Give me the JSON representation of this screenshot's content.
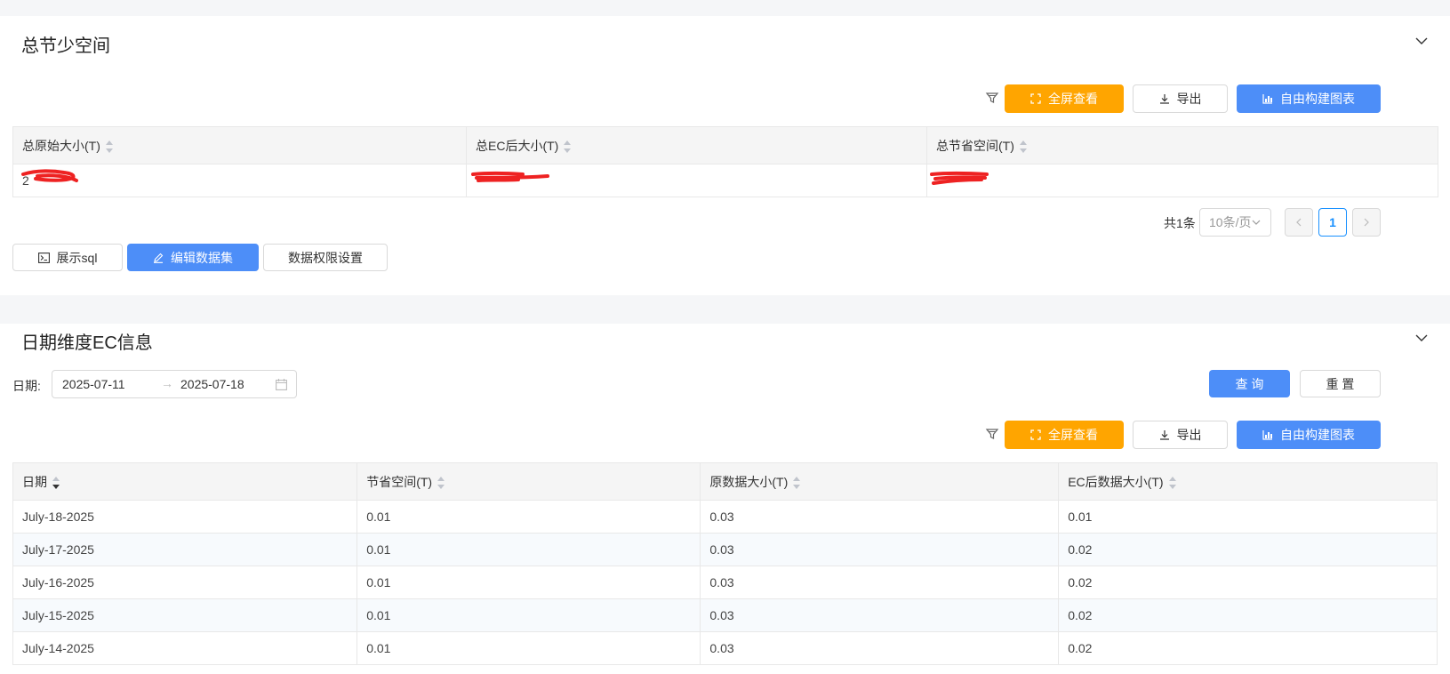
{
  "section1": {
    "title": "总节少空间",
    "toolbar": {
      "fullscreen": "全屏查看",
      "export": "导出",
      "build_chart": "自由构建图表"
    },
    "columns": [
      "总原始大小(T)",
      "总EC后大小(T)",
      "总节省空间(T)"
    ],
    "rows": [
      [
        "2",
        "",
        ""
      ]
    ],
    "pagination": {
      "total": "共1条",
      "page_size": "10条/页",
      "current_page": "1"
    },
    "actions": {
      "show_sql": "展示sql",
      "edit_dataset": "编辑数据集",
      "permissions": "数据权限设置"
    }
  },
  "section2": {
    "title": "日期维度EC信息",
    "filter": {
      "label": "日期:",
      "start": "2025-07-11",
      "end": "2025-07-18",
      "query": "查 询",
      "reset": "重 置"
    },
    "toolbar": {
      "fullscreen": "全屏查看",
      "export": "导出",
      "build_chart": "自由构建图表"
    },
    "columns": [
      "日期",
      "节省空间(T)",
      "原数据大小(T)",
      "EC后数据大小(T)"
    ],
    "rows": [
      [
        "July-18-2025",
        "0.01",
        "0.03",
        "0.01"
      ],
      [
        "July-17-2025",
        "0.01",
        "0.03",
        "0.02"
      ],
      [
        "July-16-2025",
        "0.01",
        "0.03",
        "0.02"
      ],
      [
        "July-15-2025",
        "0.01",
        "0.03",
        "0.02"
      ],
      [
        "July-14-2025",
        "0.01",
        "0.03",
        "0.02"
      ]
    ]
  },
  "colors": {
    "orange": "#ffa500",
    "blue": "#4d8ef8",
    "redaction": "#ee2222",
    "page_active": "#1890ff"
  }
}
